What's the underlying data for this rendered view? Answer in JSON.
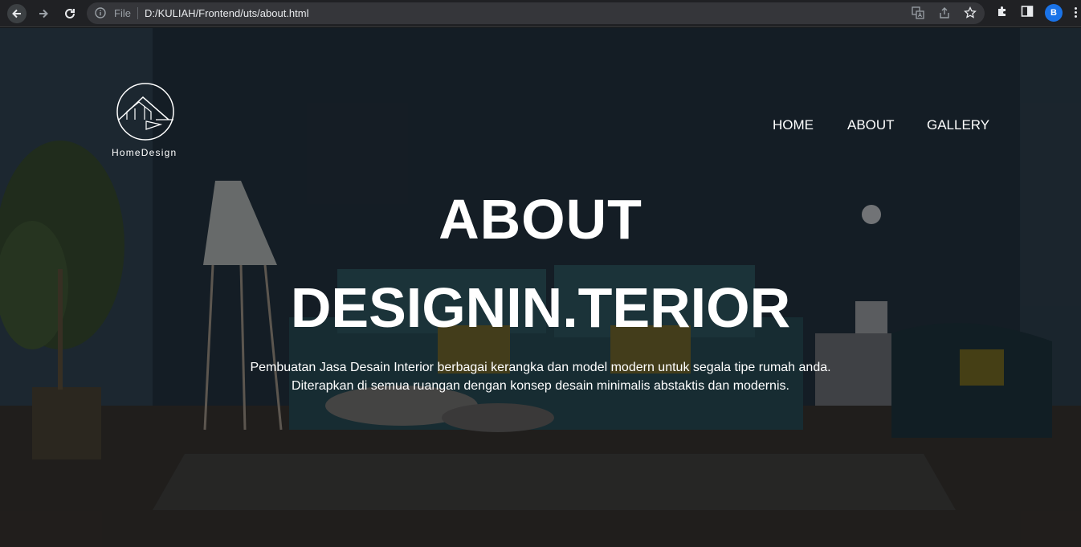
{
  "browser": {
    "scheme_label": "File",
    "url": "D:/KULIAH/Frontend/uts/about.html",
    "profile_initial": "B",
    "accent_color": "#1a73e8"
  },
  "site": {
    "logo_text": "HomeDesign",
    "nav": {
      "home": "HOME",
      "about": "ABOUT",
      "gallery": "GALLERY"
    },
    "hero": {
      "title_line1": "ABOUT",
      "title_line2": "DESIGNIN.TERIOR",
      "desc_line1": "Pembuatan Jasa Desain Interior berbagai kerangka dan model modern untuk segala tipe rumah anda.",
      "desc_line2": "Diterapkan di semua ruangan dengan konsep desain minimalis abstaktis dan modernis."
    }
  }
}
